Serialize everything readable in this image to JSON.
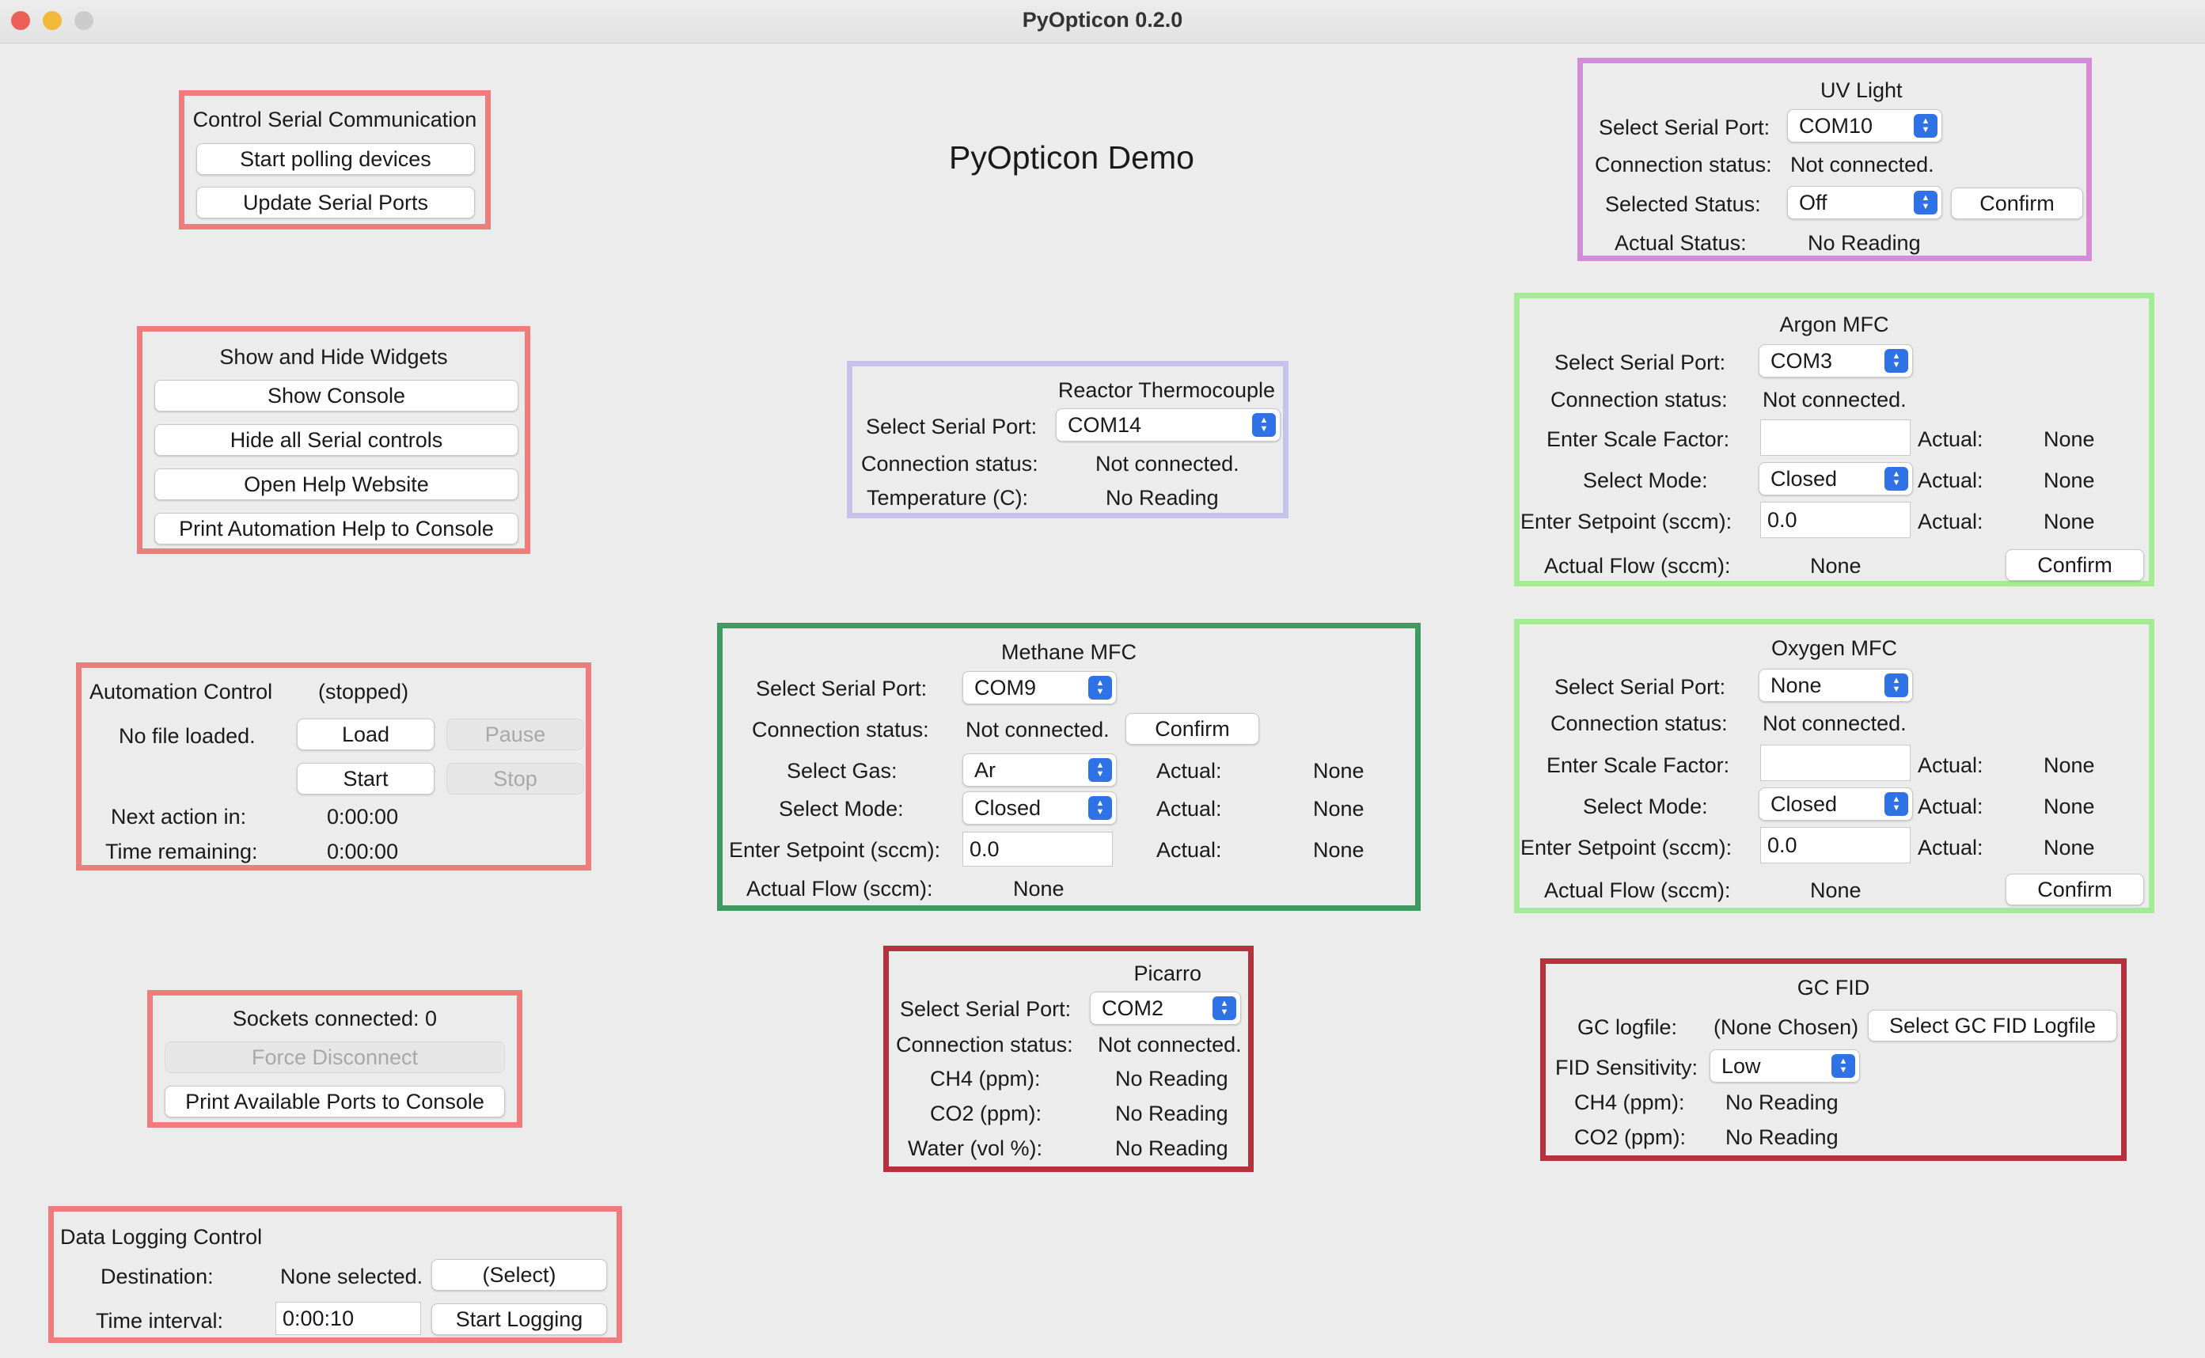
{
  "window": {
    "title": "PyOpticon 0.2.0",
    "traffic_lights": [
      "#ec5f58",
      "#f2b839",
      "#cccccc"
    ]
  },
  "demo_title": "PyOpticon Demo",
  "colors": {
    "control_frame": "#ee7d7b",
    "uv_frame": "#d48bd8",
    "thermo_frame": "#c7c3e8",
    "methane_frame": "#3f9a61",
    "mfc_frame": "#a2ec94",
    "analyzer_frame": "#b3323c",
    "select_arrow": "#2f72e6"
  },
  "serial": {
    "title": "Control Serial Communication",
    "start_polling": "Start polling devices",
    "update_ports": "Update Serial Ports"
  },
  "widgets": {
    "title": "Show and Hide Widgets",
    "show_console": "Show Console",
    "hide_serial": "Hide all Serial controls",
    "open_help": "Open Help Website",
    "print_help": "Print Automation Help to Console"
  },
  "automation": {
    "title": "Automation Control",
    "state": "(stopped)",
    "file": "No file loaded.",
    "load": "Load",
    "pause": "Pause",
    "start": "Start",
    "stop": "Stop",
    "next_label": "Next action in:",
    "next_value": "0:00:00",
    "remaining_label": "Time remaining:",
    "remaining_value": "0:00:00"
  },
  "sockets": {
    "connected": "Sockets connected: 0",
    "force_disconnect": "Force Disconnect",
    "print_ports": "Print Available Ports to Console"
  },
  "logging": {
    "title": "Data Logging Control",
    "destination_label": "Destination:",
    "destination_value": "None selected.",
    "select": "(Select)",
    "interval_label": "Time interval:",
    "interval_value": "0:00:10",
    "start": "Start Logging"
  },
  "thermo": {
    "title": "Reactor Thermocouple",
    "port_label": "Select Serial Port:",
    "port": "COM14",
    "conn_label": "Connection status:",
    "conn": "Not connected.",
    "temp_label": "Temperature (C):",
    "temp": "No Reading"
  },
  "methane": {
    "title": "Methane MFC",
    "port_label": "Select Serial Port:",
    "port": "COM9",
    "conn_label": "Connection status:",
    "conn": "Not connected.",
    "confirm": "Confirm",
    "gas_label": "Select Gas:",
    "gas": "Ar",
    "mode_label": "Select Mode:",
    "mode": "Closed",
    "setpoint_label": "Enter Setpoint (sccm):",
    "setpoint": "0.0",
    "actual_label": "Actual:",
    "actual_gas": "None",
    "actual_mode": "None",
    "actual_setpoint": "None",
    "flow_label": "Actual Flow (sccm):",
    "flow": "None"
  },
  "picarro": {
    "title": "Picarro",
    "port_label": "Select Serial Port:",
    "port": "COM2",
    "conn_label": "Connection status:",
    "conn": "Not connected.",
    "ch4_label": "CH4 (ppm):",
    "ch4": "No Reading",
    "co2_label": "CO2 (ppm):",
    "co2": "No Reading",
    "water_label": "Water (vol %):",
    "water": "No Reading"
  },
  "uv": {
    "title": "UV Light",
    "port_label": "Select Serial Port:",
    "port": "COM10",
    "conn_label": "Connection status:",
    "conn": "Not connected.",
    "status_label": "Selected Status:",
    "status": "Off",
    "confirm": "Confirm",
    "actual_label": "Actual Status:",
    "actual": "No Reading"
  },
  "argon": {
    "title": "Argon MFC",
    "port_label": "Select Serial Port:",
    "port": "COM3",
    "conn_label": "Connection status:",
    "conn": "Not connected.",
    "scale_label": "Enter Scale Factor:",
    "scale": "",
    "mode_label": "Select Mode:",
    "mode": "Closed",
    "setpoint_label": "Enter Setpoint (sccm):",
    "setpoint": "0.0",
    "actual_label": "Actual:",
    "actual_scale": "None",
    "actual_mode": "None",
    "actual_setpoint": "None",
    "flow_label": "Actual Flow (sccm):",
    "flow": "None",
    "confirm": "Confirm"
  },
  "oxygen": {
    "title": "Oxygen MFC",
    "port_label": "Select Serial Port:",
    "port": "None",
    "conn_label": "Connection status:",
    "conn": "Not connected.",
    "scale_label": "Enter Scale Factor:",
    "scale": "",
    "mode_label": "Select Mode:",
    "mode": "Closed",
    "setpoint_label": "Enter Setpoint (sccm):",
    "setpoint": "0.0",
    "actual_label": "Actual:",
    "actual_scale": "None",
    "actual_mode": "None",
    "actual_setpoint": "None",
    "flow_label": "Actual Flow (sccm):",
    "flow": "None",
    "confirm": "Confirm"
  },
  "gcfid": {
    "title": "GC FID",
    "logfile_label": "GC logfile:",
    "logfile": "(None Chosen)",
    "select_logfile": "Select GC FID Logfile",
    "sens_label": "FID Sensitivity:",
    "sens": "Low",
    "ch4_label": "CH4 (ppm):",
    "ch4": "No Reading",
    "co2_label": "CO2 (ppm):",
    "co2": "No Reading"
  }
}
